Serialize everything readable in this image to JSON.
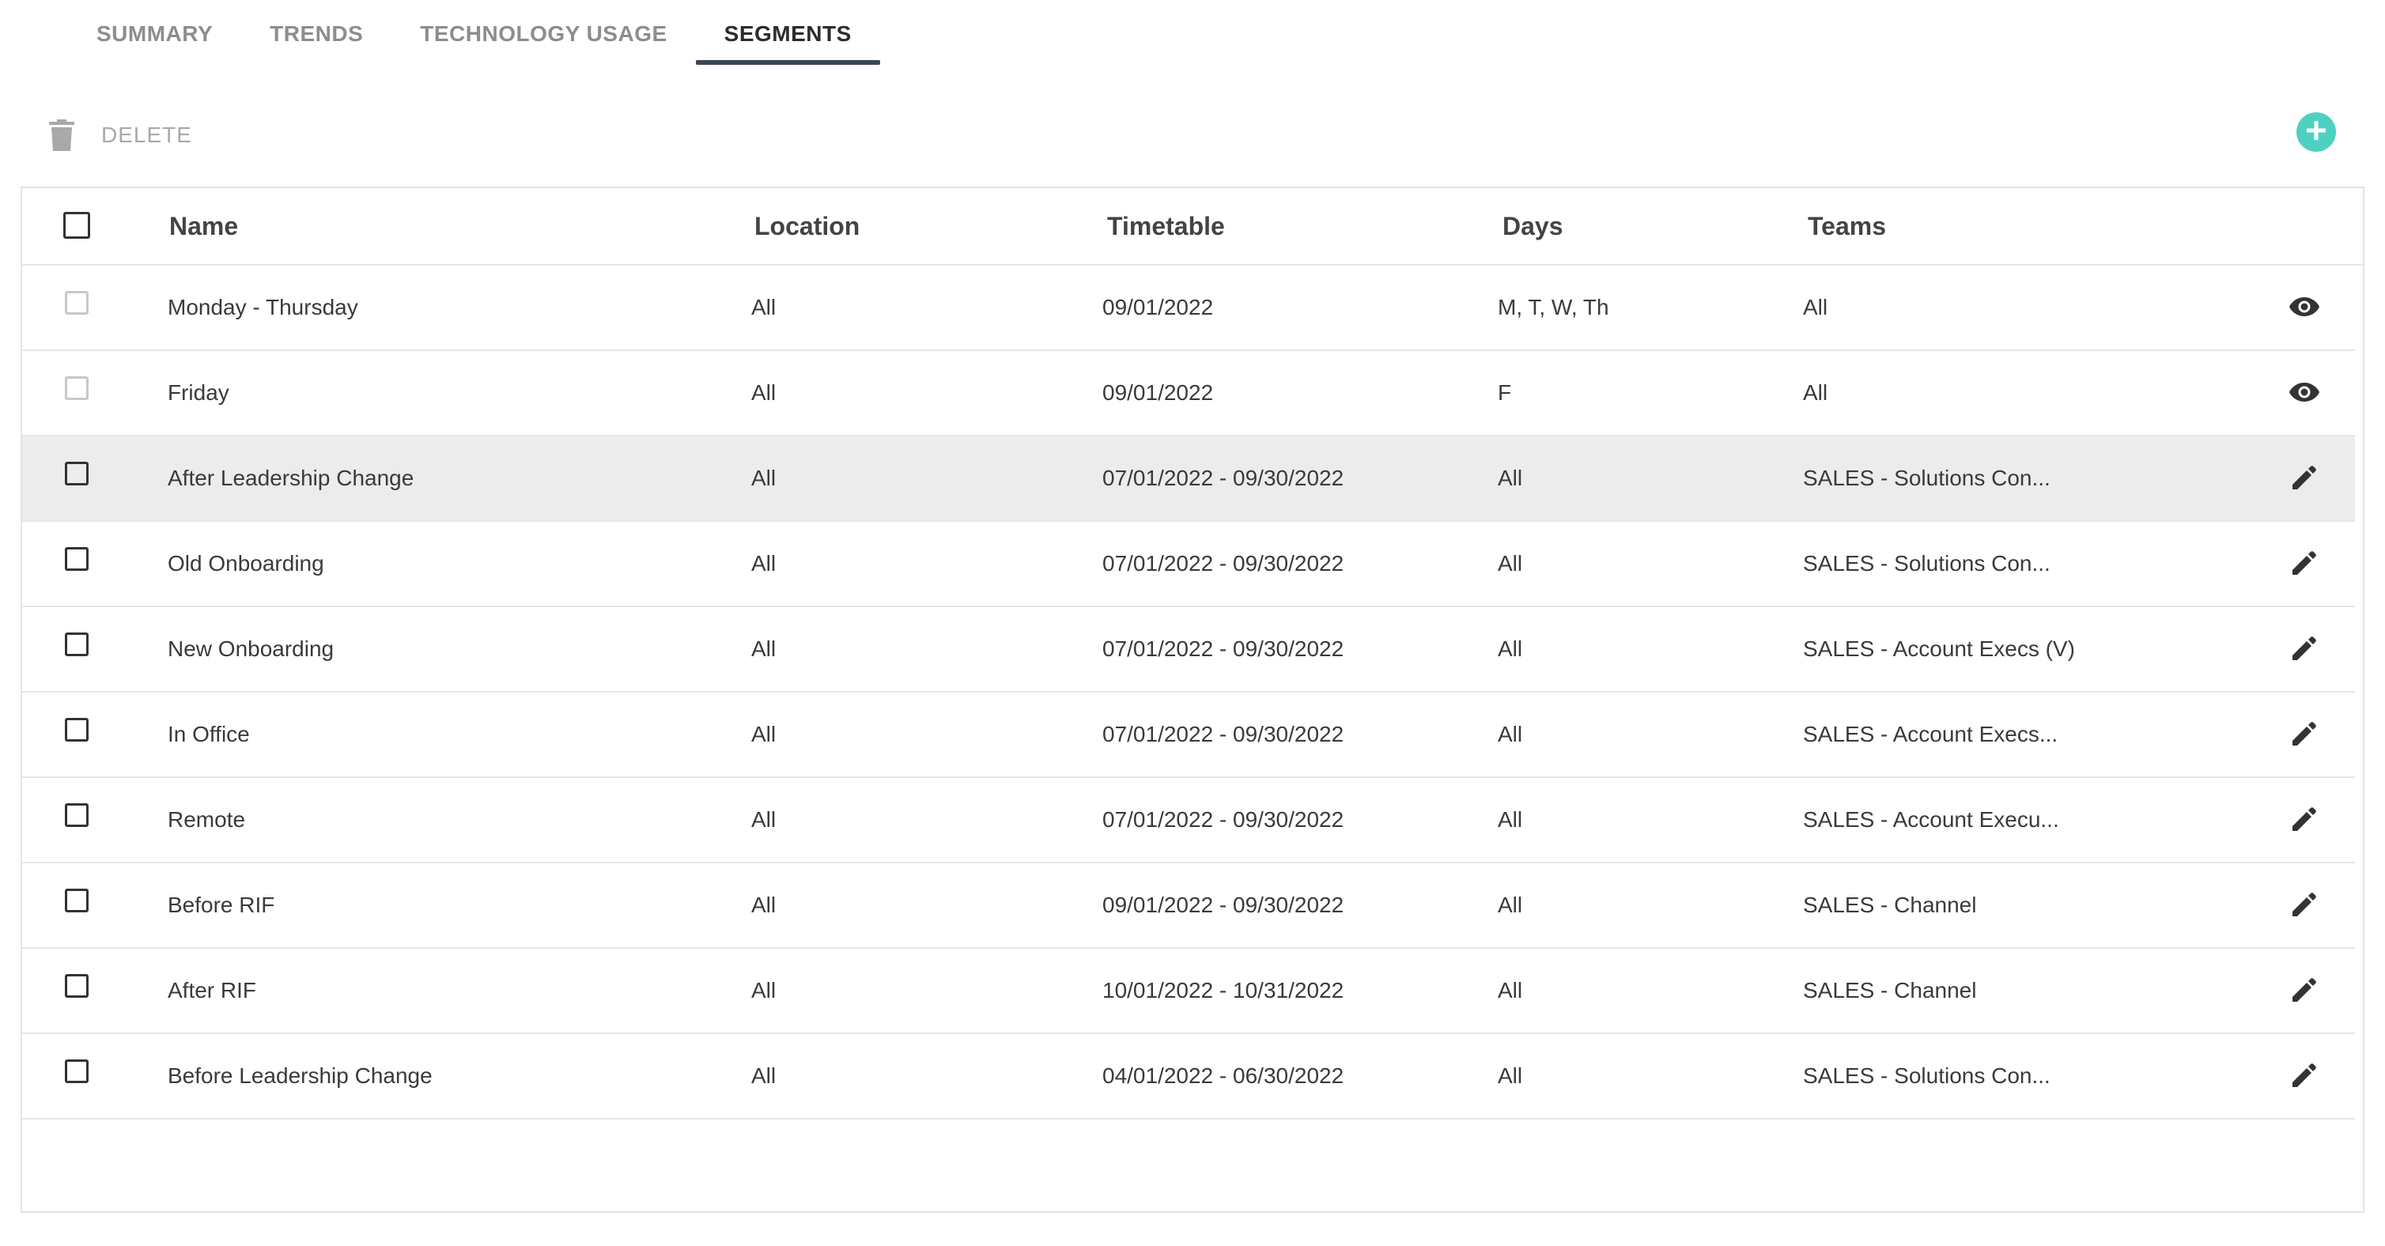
{
  "tabs": [
    {
      "label": "SUMMARY",
      "active": false
    },
    {
      "label": "TRENDS",
      "active": false
    },
    {
      "label": "TECHNOLOGY USAGE",
      "active": false
    },
    {
      "label": "SEGMENTS",
      "active": true
    }
  ],
  "toolbar": {
    "delete_label": "DELETE",
    "delete_icon": "trash-icon",
    "add_icon": "plus-circle-icon",
    "add_color": "#4fd1c1"
  },
  "table": {
    "headers": {
      "name": "Name",
      "location": "Location",
      "timetable": "Timetable",
      "days": "Days",
      "teams": "Teams"
    },
    "rows": [
      {
        "name": "Monday - Thursday",
        "location": "All",
        "timetable": "09/01/2022",
        "days": "M, T, W, Th",
        "teams": "All",
        "action": "view",
        "checkbox_enabled": false,
        "highlighted": false
      },
      {
        "name": "Friday",
        "location": "All",
        "timetable": "09/01/2022",
        "days": "F",
        "teams": "All",
        "action": "view",
        "checkbox_enabled": false,
        "highlighted": false
      },
      {
        "name": "After Leadership Change",
        "location": "All",
        "timetable": "07/01/2022 - 09/30/2022",
        "days": "All",
        "teams": "SALES - Solutions Con...",
        "action": "edit",
        "checkbox_enabled": true,
        "highlighted": true
      },
      {
        "name": "Old Onboarding",
        "location": "All",
        "timetable": "07/01/2022 - 09/30/2022",
        "days": "All",
        "teams": "SALES - Solutions Con...",
        "action": "edit",
        "checkbox_enabled": true,
        "highlighted": false
      },
      {
        "name": "New Onboarding",
        "location": "All",
        "timetable": "07/01/2022 - 09/30/2022",
        "days": "All",
        "teams": "SALES - Account Execs (V)",
        "action": "edit",
        "checkbox_enabled": true,
        "highlighted": false
      },
      {
        "name": "In Office",
        "location": "All",
        "timetable": "07/01/2022 - 09/30/2022",
        "days": "All",
        "teams": "SALES - Account Execs...",
        "action": "edit",
        "checkbox_enabled": true,
        "highlighted": false
      },
      {
        "name": "Remote",
        "location": "All",
        "timetable": "07/01/2022 - 09/30/2022",
        "days": "All",
        "teams": "SALES - Account Execu...",
        "action": "edit",
        "checkbox_enabled": true,
        "highlighted": false
      },
      {
        "name": "Before RIF",
        "location": "All",
        "timetable": "09/01/2022 - 09/30/2022",
        "days": "All",
        "teams": "SALES - Channel",
        "action": "edit",
        "checkbox_enabled": true,
        "highlighted": false
      },
      {
        "name": "After RIF",
        "location": "All",
        "timetable": "10/01/2022 - 10/31/2022",
        "days": "All",
        "teams": "SALES - Channel",
        "action": "edit",
        "checkbox_enabled": true,
        "highlighted": false
      },
      {
        "name": "Before Leadership Change",
        "location": "All",
        "timetable": "04/01/2022 - 06/30/2022",
        "days": "All",
        "teams": "SALES - Solutions Con...",
        "action": "edit",
        "checkbox_enabled": true,
        "highlighted": false
      }
    ]
  },
  "icons": {
    "view": "eye-icon",
    "edit": "pencil-icon"
  }
}
